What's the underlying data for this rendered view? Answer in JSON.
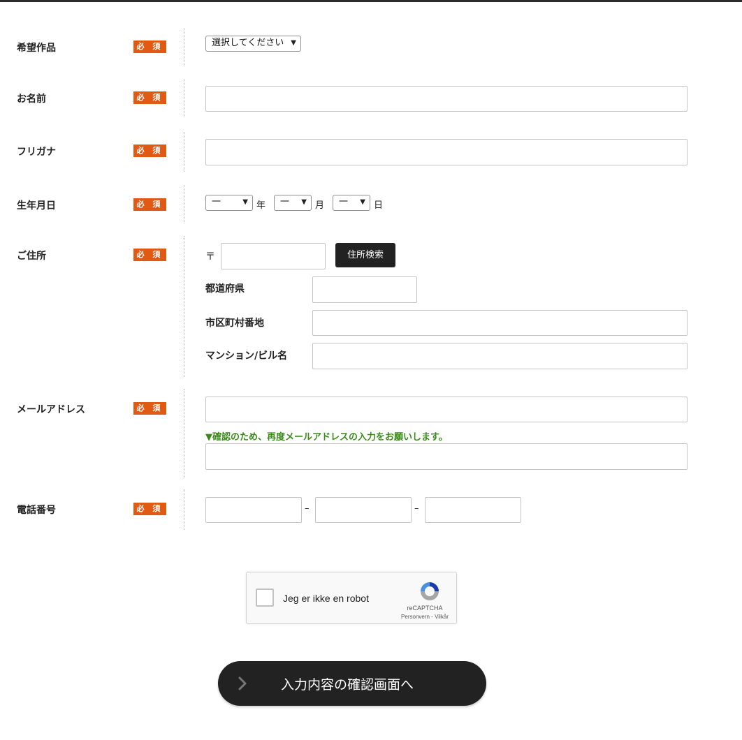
{
  "required_badge": "必 須",
  "rows": {
    "work": {
      "label": "希望作品",
      "select": "選択してください"
    },
    "name": {
      "label": "お名前"
    },
    "kana": {
      "label": "フリガナ"
    },
    "birth": {
      "label": "生年月日",
      "year_value": "一",
      "year_unit": "年",
      "month_value": "一",
      "month_unit": "月",
      "day_value": "一",
      "day_unit": "日"
    },
    "address": {
      "label": "ご住所",
      "postal_mark": "〒",
      "search_button": "住所検索",
      "prefecture": "都道府県",
      "city": "市区町村番地",
      "building": "マンション/ビル名"
    },
    "email": {
      "label": "メールアドレス",
      "confirm_note": "▼確認のため、再度メールアドレスの入力をお願いします。"
    },
    "phone": {
      "label": "電話番号",
      "separator": "–"
    }
  },
  "captcha": {
    "checkbox_label": "Jeg er ikke en robot",
    "brand": "reCAPTCHA",
    "links": "Personvern - Vilkår"
  },
  "submit": {
    "label": "入力内容の確認画面へ",
    "icon": "chevron-right-icon"
  },
  "colors": {
    "required": "#e05a14",
    "note": "#3a8a1a",
    "button": "#222222"
  }
}
